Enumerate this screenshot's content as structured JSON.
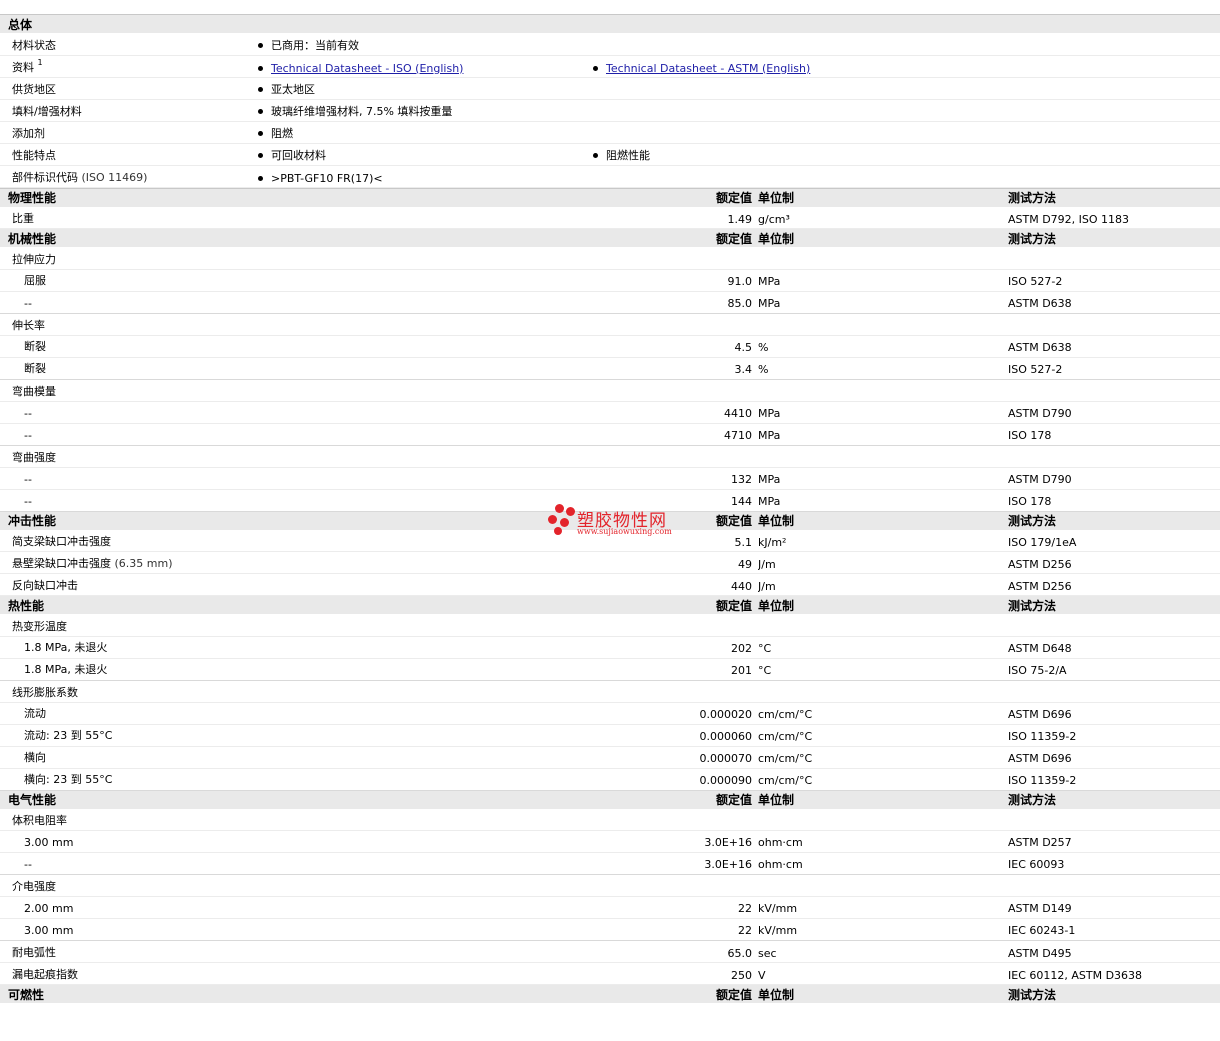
{
  "general": {
    "section_label": "总体",
    "rows": [
      {
        "label": "材料状态",
        "items": [
          "已商用：当前有效"
        ]
      },
      {
        "label": "资料",
        "sup": "1",
        "links": [
          "Technical Datasheet - ISO (English)",
          "Technical Datasheet - ASTM (English)"
        ]
      },
      {
        "label": "供货地区",
        "items": [
          "亚太地区"
        ]
      },
      {
        "label": "填料/增强材料",
        "items": [
          "玻璃纤维增强材料, 7.5% 填料按重量"
        ]
      },
      {
        "label": "添加剂",
        "items": [
          "阻燃"
        ]
      },
      {
        "label": "性能特点",
        "items": [
          "可回收材料",
          "阻燃性能"
        ]
      },
      {
        "label": "部件标识代码",
        "note": "(ISO 11469)",
        "items": [
          ">PBT-GF10 FR(17)<"
        ]
      }
    ]
  },
  "headers": {
    "value": "额定值",
    "unit": "单位制",
    "method": "测试方法"
  },
  "sections": [
    {
      "label": "物理性能",
      "rows": [
        {
          "type": "row",
          "label": "比重",
          "value": "1.49",
          "unit": "g/cm³",
          "method": "ASTM D792, ISO 1183"
        }
      ]
    },
    {
      "label": "机械性能",
      "rows": [
        {
          "type": "group",
          "label": "拉伸应力"
        },
        {
          "type": "sub",
          "label": "屈服",
          "value": "91.0",
          "unit": "MPa",
          "method": "ISO 527-2"
        },
        {
          "type": "sub",
          "label": "--",
          "value": "85.0",
          "unit": "MPa",
          "method": "ASTM D638",
          "last": true
        },
        {
          "type": "group",
          "label": "伸长率"
        },
        {
          "type": "sub",
          "label": "断裂",
          "value": "4.5",
          "unit": "%",
          "method": "ASTM D638"
        },
        {
          "type": "sub",
          "label": "断裂",
          "value": "3.4",
          "unit": "%",
          "method": "ISO 527-2",
          "last": true
        },
        {
          "type": "group",
          "label": "弯曲模量"
        },
        {
          "type": "sub",
          "label": "--",
          "value": "4410",
          "unit": "MPa",
          "method": "ASTM D790"
        },
        {
          "type": "sub",
          "label": "--",
          "value": "4710",
          "unit": "MPa",
          "method": "ISO 178",
          "last": true
        },
        {
          "type": "group",
          "label": "弯曲强度"
        },
        {
          "type": "sub",
          "label": "--",
          "value": "132",
          "unit": "MPa",
          "method": "ASTM D790"
        },
        {
          "type": "sub",
          "label": "--",
          "value": "144",
          "unit": "MPa",
          "method": "ISO 178",
          "last": true
        }
      ]
    },
    {
      "label": "冲击性能",
      "rows": [
        {
          "type": "row",
          "label": "简支梁缺口冲击强度",
          "value": "5.1",
          "unit": "kJ/m²",
          "method": "ISO 179/1eA"
        },
        {
          "type": "row",
          "label": "悬壁梁缺口冲击强度",
          "note": "(6.35 mm)",
          "value": "49",
          "unit": "J/m",
          "method": "ASTM D256"
        },
        {
          "type": "row",
          "label": "反向缺口冲击",
          "value": "440",
          "unit": "J/m",
          "method": "ASTM D256"
        }
      ]
    },
    {
      "label": "热性能",
      "rows": [
        {
          "type": "group",
          "label": "热变形温度"
        },
        {
          "type": "sub",
          "label": "1.8 MPa, 未退火",
          "value": "202",
          "unit": "°C",
          "method": "ASTM D648"
        },
        {
          "type": "sub",
          "label": "1.8 MPa, 未退火",
          "value": "201",
          "unit": "°C",
          "method": "ISO 75-2/A",
          "last": true
        },
        {
          "type": "group",
          "label": "线形膨胀系数"
        },
        {
          "type": "sub",
          "label": "流动",
          "value": "0.000020",
          "unit": "cm/cm/°C",
          "method": "ASTM D696"
        },
        {
          "type": "sub",
          "label": "流动: 23 到  55°C",
          "value": "0.000060",
          "unit": "cm/cm/°C",
          "method": "ISO 11359-2"
        },
        {
          "type": "sub",
          "label": "横向",
          "value": "0.000070",
          "unit": "cm/cm/°C",
          "method": "ASTM D696"
        },
        {
          "type": "sub",
          "label": "横向: 23 到  55°C",
          "value": "0.000090",
          "unit": "cm/cm/°C",
          "method": "ISO 11359-2",
          "last": true
        }
      ]
    },
    {
      "label": "电气性能",
      "rows": [
        {
          "type": "group",
          "label": "体积电阻率"
        },
        {
          "type": "sub",
          "label": "3.00 mm",
          "value": "3.0E+16",
          "unit": "ohm·cm",
          "method": "ASTM D257"
        },
        {
          "type": "sub",
          "label": "--",
          "value": "3.0E+16",
          "unit": "ohm·cm",
          "method": "IEC 60093",
          "last": true
        },
        {
          "type": "group",
          "label": "介电强度"
        },
        {
          "type": "sub",
          "label": "2.00 mm",
          "value": "22",
          "unit": "kV/mm",
          "method": "ASTM D149"
        },
        {
          "type": "sub",
          "label": "3.00 mm",
          "value": "22",
          "unit": "kV/mm",
          "method": "IEC 60243-1",
          "last": true
        },
        {
          "type": "row",
          "label": "耐电弧性",
          "value": "65.0",
          "unit": "sec",
          "method": "ASTM D495"
        },
        {
          "type": "row",
          "label": "漏电起痕指数",
          "value": "250",
          "unit": "V",
          "method": "IEC 60112, ASTM D3638"
        }
      ]
    },
    {
      "label": "可燃性",
      "rows": []
    }
  ],
  "watermark": {
    "text": "塑胶物性网",
    "url": "www.sujiaowuxing.com"
  }
}
